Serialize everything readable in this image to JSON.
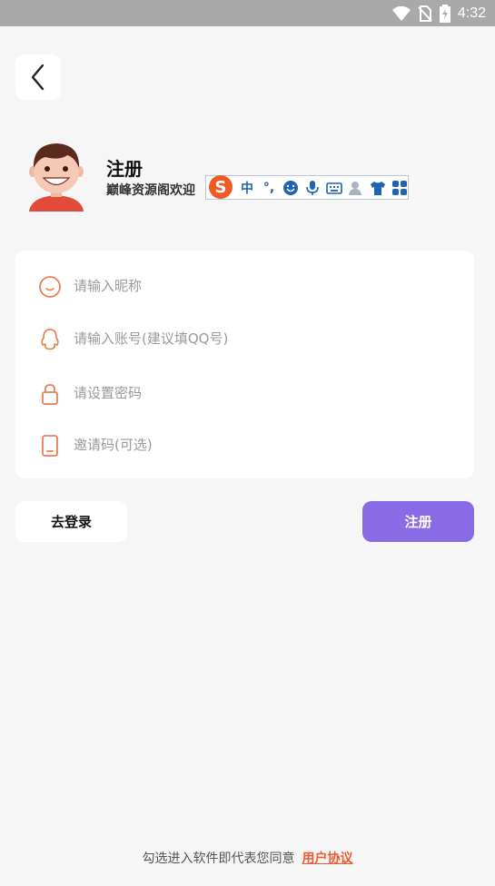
{
  "status_bar": {
    "time": "4:32",
    "icons": [
      "wifi-icon",
      "no-sim-icon",
      "battery-charging-icon"
    ]
  },
  "header": {
    "back_icon": "chevron-left-icon"
  },
  "profile": {
    "title": "注册",
    "subtitle": "巅峰资源阁欢迎"
  },
  "ime_toolbar": {
    "logo": "S",
    "items": [
      "中",
      "°,",
      "emoji-icon",
      "mic-icon",
      "keyboard-icon",
      "user-icon",
      "shirt-icon",
      "grid-icon"
    ],
    "label_cn": "中",
    "label_punct": "°,"
  },
  "form": {
    "nickname_placeholder": "请输入昵称",
    "account_placeholder": "请输入账号(建议填QQ号)",
    "password_placeholder": "请设置密码",
    "invite_placeholder": "邀请码(可选)"
  },
  "actions": {
    "login_label": "去登录",
    "register_label": "注册"
  },
  "footer": {
    "agreement_text": "勾选进入软件即代表您同意",
    "agreement_link": "用户协议"
  },
  "colors": {
    "accent": "#8a6be6",
    "icon_orange": "#ea7f52",
    "link": "#ea5b2d",
    "status_bar": "#a9a9a9"
  }
}
